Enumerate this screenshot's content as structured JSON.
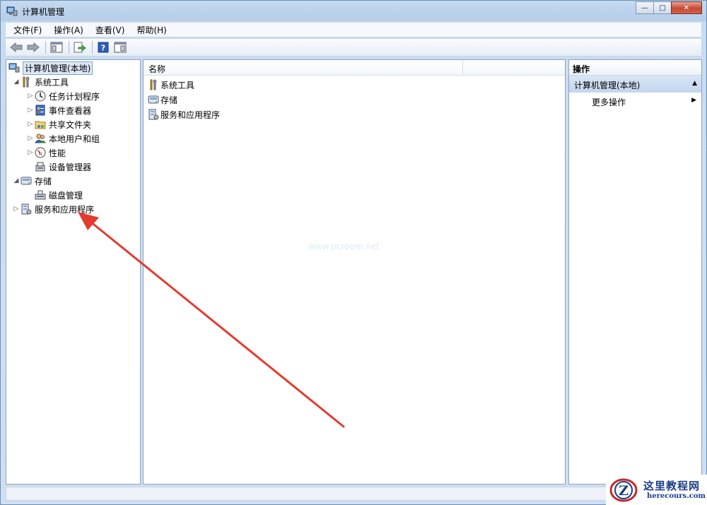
{
  "window": {
    "title": "计算机管理",
    "controls": {
      "minimize": "—",
      "maximize": "□",
      "close": "✕"
    }
  },
  "menu": [
    "文件(F)",
    "操作(A)",
    "查看(V)",
    "帮助(H)"
  ],
  "toolbar": {
    "buttons": [
      "back-arrow-icon",
      "forward-arrow-icon",
      "show-hide-console-tree-icon",
      "export-list-icon",
      "help-icon",
      "show-hide-action-pane-icon"
    ]
  },
  "tree": {
    "root": "计算机管理(本地)",
    "system_tools": "系统工具",
    "task_scheduler": "任务计划程序",
    "event_viewer": "事件查看器",
    "shared_folders": "共享文件夹",
    "local_users": "本地用户和组",
    "performance": "性能",
    "device_manager": "设备管理器",
    "storage": "存储",
    "disk_management": "磁盘管理",
    "services_apps": "服务和应用程序"
  },
  "list": {
    "column_name": "名称",
    "items": [
      "系统工具",
      "存储",
      "服务和应用程序"
    ]
  },
  "actions": {
    "header": "操作",
    "group": "计算机管理(本地)",
    "more": "更多操作"
  },
  "watermark": "www.pcroom.net",
  "logo": {
    "site": "这里教程网",
    "url": "herecours.com",
    "letter": "Z"
  },
  "colors": {
    "annotation_arrow": "#e53a2f",
    "selection": "#dde8f6",
    "frame": "#c5d9ef"
  }
}
